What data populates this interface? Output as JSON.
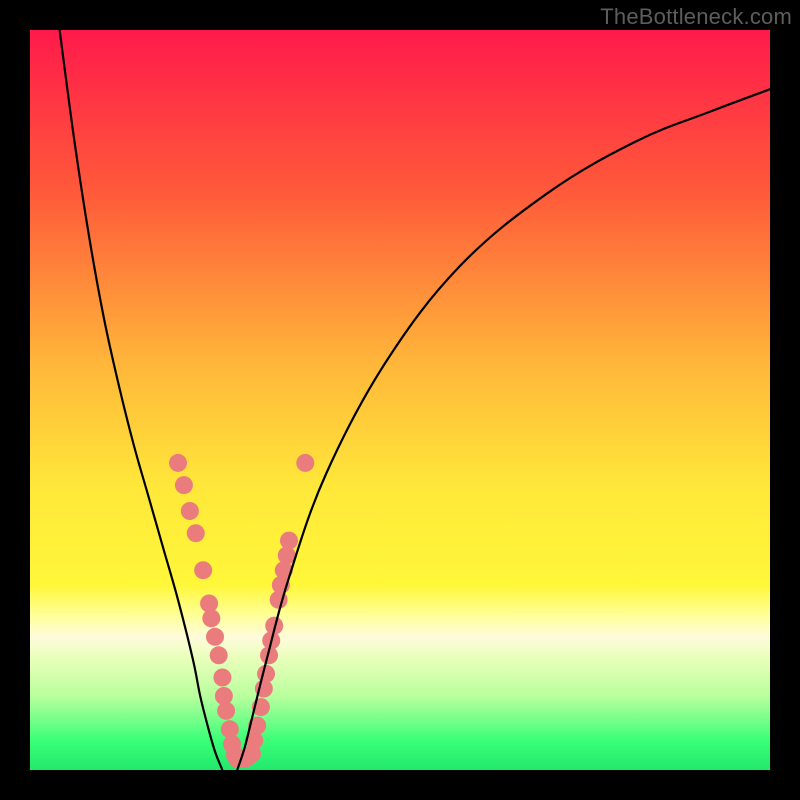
{
  "watermark": "TheBottleneck.com",
  "chart_data": {
    "type": "line",
    "title": "",
    "xlabel": "",
    "ylabel": "",
    "xlim": [
      0,
      100
    ],
    "ylim": [
      0,
      100
    ],
    "gradient_stops": [
      {
        "offset": 0,
        "color": "#ff1a4b"
      },
      {
        "offset": 22,
        "color": "#ff5a3a"
      },
      {
        "offset": 45,
        "color": "#ffb63a"
      },
      {
        "offset": 62,
        "color": "#ffe83a"
      },
      {
        "offset": 75,
        "color": "#fff73a"
      },
      {
        "offset": 79,
        "color": "#ffff96"
      },
      {
        "offset": 82,
        "color": "#fffbdc"
      },
      {
        "offset": 85,
        "color": "#e8ffb9"
      },
      {
        "offset": 90,
        "color": "#b9ff9e"
      },
      {
        "offset": 96,
        "color": "#3aff77"
      },
      {
        "offset": 100,
        "color": "#22e86d"
      }
    ],
    "series": [
      {
        "name": "left-curve",
        "x": [
          4,
          6,
          8,
          10,
          12,
          14,
          16,
          18,
          20,
          22,
          23,
          24,
          25,
          26
        ],
        "y": [
          100,
          85,
          72,
          61,
          52,
          44,
          37,
          30,
          23,
          15,
          10,
          6,
          2.5,
          0
        ]
      },
      {
        "name": "right-curve",
        "x": [
          28,
          29,
          30,
          32,
          35,
          40,
          48,
          58,
          70,
          82,
          92,
          100
        ],
        "y": [
          0,
          3,
          7,
          15,
          26,
          40,
          55,
          68,
          78,
          85,
          89,
          92
        ]
      }
    ],
    "markers": {
      "name": "highlight-points",
      "color": "#ea7c7e",
      "radius": 9,
      "points": [
        {
          "x": 20.0,
          "y": 41.5
        },
        {
          "x": 20.8,
          "y": 38.5
        },
        {
          "x": 21.6,
          "y": 35.0
        },
        {
          "x": 22.4,
          "y": 32.0
        },
        {
          "x": 23.4,
          "y": 27.0
        },
        {
          "x": 24.2,
          "y": 22.5
        },
        {
          "x": 24.5,
          "y": 20.5
        },
        {
          "x": 25.0,
          "y": 18.0
        },
        {
          "x": 25.5,
          "y": 15.5
        },
        {
          "x": 26.0,
          "y": 12.5
        },
        {
          "x": 26.2,
          "y": 10.0
        },
        {
          "x": 26.5,
          "y": 8.0
        },
        {
          "x": 27.0,
          "y": 5.5
        },
        {
          "x": 27.3,
          "y": 3.5
        },
        {
          "x": 27.7,
          "y": 2.0
        },
        {
          "x": 28.0,
          "y": 1.5
        },
        {
          "x": 28.5,
          "y": 1.5
        },
        {
          "x": 29.0,
          "y": 1.5
        },
        {
          "x": 29.5,
          "y": 1.8
        },
        {
          "x": 30.0,
          "y": 2.2
        },
        {
          "x": 30.3,
          "y": 4.0
        },
        {
          "x": 30.7,
          "y": 6.0
        },
        {
          "x": 31.2,
          "y": 8.5
        },
        {
          "x": 31.6,
          "y": 11.0
        },
        {
          "x": 31.9,
          "y": 13.0
        },
        {
          "x": 32.3,
          "y": 15.5
        },
        {
          "x": 32.6,
          "y": 17.5
        },
        {
          "x": 33.0,
          "y": 19.5
        },
        {
          "x": 33.6,
          "y": 23.0
        },
        {
          "x": 33.9,
          "y": 25.0
        },
        {
          "x": 34.3,
          "y": 27.0
        },
        {
          "x": 34.7,
          "y": 29.0
        },
        {
          "x": 35.0,
          "y": 31.0
        },
        {
          "x": 37.2,
          "y": 41.5
        }
      ]
    }
  }
}
